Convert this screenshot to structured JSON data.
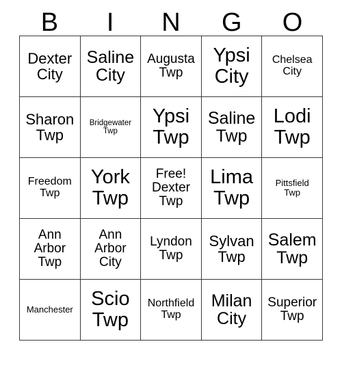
{
  "card": {
    "header_letters": [
      "B",
      "I",
      "N",
      "G",
      "O"
    ],
    "columns": 5,
    "rows": 5,
    "background_color": "#ffffff",
    "border_color": "#3a3a3a",
    "text_color": "#000000",
    "free_space": {
      "row": 3,
      "column": 3,
      "label": "Free!"
    },
    "cells": [
      [
        {
          "text": "Dexter\nCity",
          "size": "lg"
        },
        {
          "text": "Saline\nCity",
          "size": "xl"
        },
        {
          "text": "Augusta\nTwp",
          "size": "md"
        },
        {
          "text": "Ypsi\nCity",
          "size": "xxl"
        },
        {
          "text": "Chelsea\nCity",
          "size": "sm"
        }
      ],
      [
        {
          "text": "Sharon\nTwp",
          "size": "lg"
        },
        {
          "text": "Bridgewater\nTwp",
          "size": "xxs"
        },
        {
          "text": "Ypsi\nTwp",
          "size": "xxl"
        },
        {
          "text": "Saline\nTwp",
          "size": "xl"
        },
        {
          "text": "Lodi\nTwp",
          "size": "xxl"
        }
      ],
      [
        {
          "text": "Freedom\nTwp",
          "size": "sm"
        },
        {
          "text": "York\nTwp",
          "size": "xxl"
        },
        {
          "text": "Free!\nDexter\nTwp",
          "size": "md"
        },
        {
          "text": "Lima\nTwp",
          "size": "xxl"
        },
        {
          "text": "Pittsfield\nTwp",
          "size": "xs"
        }
      ],
      [
        {
          "text": "Ann\nArbor\nTwp",
          "size": "md"
        },
        {
          "text": "Ann\nArbor\nCity",
          "size": "md"
        },
        {
          "text": "Lyndon\nTwp",
          "size": "md"
        },
        {
          "text": "Sylvan\nTwp",
          "size": "lg"
        },
        {
          "text": "Salem\nTwp",
          "size": "xl"
        }
      ],
      [
        {
          "text": "Manchester",
          "size": "xs"
        },
        {
          "text": "Scio\nTwp",
          "size": "xxl"
        },
        {
          "text": "Northfield\nTwp",
          "size": "sm"
        },
        {
          "text": "Milan\nCity",
          "size": "xl"
        },
        {
          "text": "Superior\nTwp",
          "size": "md"
        }
      ]
    ]
  }
}
